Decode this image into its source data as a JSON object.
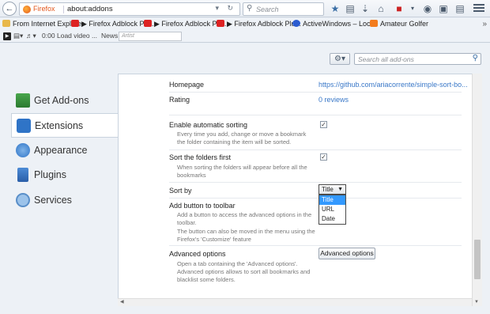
{
  "navbar": {
    "browser_label": "Firefox",
    "url": "about:addons",
    "url_controls": "▾ ↻",
    "search_placeholder": "Search"
  },
  "bookmarks": [
    {
      "label": "From Internet Explorer",
      "icon": "folder-icon"
    },
    {
      "label": "▶ Firefox Adblock Plu...",
      "icon": "youtube-icon"
    },
    {
      "label": "▶ Firefox Adblock Plu...",
      "icon": "youtube-icon"
    },
    {
      "label": "▶ Firefox Adblock Plu...",
      "icon": "youtube-icon"
    },
    {
      "label": "ActiveWindows – Loc...",
      "icon": "activewindows-icon"
    },
    {
      "label": "Amateur Golfer",
      "icon": "blogger-icon"
    }
  ],
  "bookmarks_overflow": "»",
  "mediabar": {
    "time": "0:00",
    "load_label": "Load video ...",
    "news_label": "News",
    "artist_placeholder": "Artist"
  },
  "addons": {
    "search_placeholder": "Search all add-ons",
    "categories": [
      {
        "label": "Get Add-ons",
        "icon": "get-addons-icon",
        "selected": false
      },
      {
        "label": "Extensions",
        "icon": "puzzle-piece-icon",
        "selected": true
      },
      {
        "label": "Appearance",
        "icon": "appearance-icon",
        "selected": false
      },
      {
        "label": "Plugins",
        "icon": "plugin-icon",
        "selected": false
      },
      {
        "label": "Services",
        "icon": "services-icon",
        "selected": false
      }
    ],
    "details": {
      "homepage_label": "Homepage",
      "homepage_value": "https://github.com/ariacorrente/simple-sort-bo...",
      "rating_label": "Rating",
      "rating_value": "0 reviews",
      "auto_sort_label": "Enable automatic sorting",
      "auto_sort_desc": "Every time you add, change or move a bookmark the folder containing the item will be sorted.",
      "auto_sort_checked": true,
      "folders_first_label": "Sort the folders first",
      "folders_first_desc": "When sorting the folders will appear before all the bookmarks",
      "folders_first_checked": true,
      "sort_by_label": "Sort by",
      "sort_by_value": "Title",
      "sort_by_options": [
        "Title",
        "URL",
        "Date"
      ],
      "toolbar_label": "Add button to toolbar",
      "toolbar_desc": "Add a button to access the advanced options in the toolbar.",
      "toolbar_desc2": "The button can also be moved in the menu using the Firefox's 'Customize' feature",
      "advanced_label": "Advanced options",
      "advanced_desc": "Open a tab containing the 'Advanced options'. Advanced options allows to sort all bookmarks and blacklist some folders.",
      "advanced_button": "Advanced options"
    }
  }
}
